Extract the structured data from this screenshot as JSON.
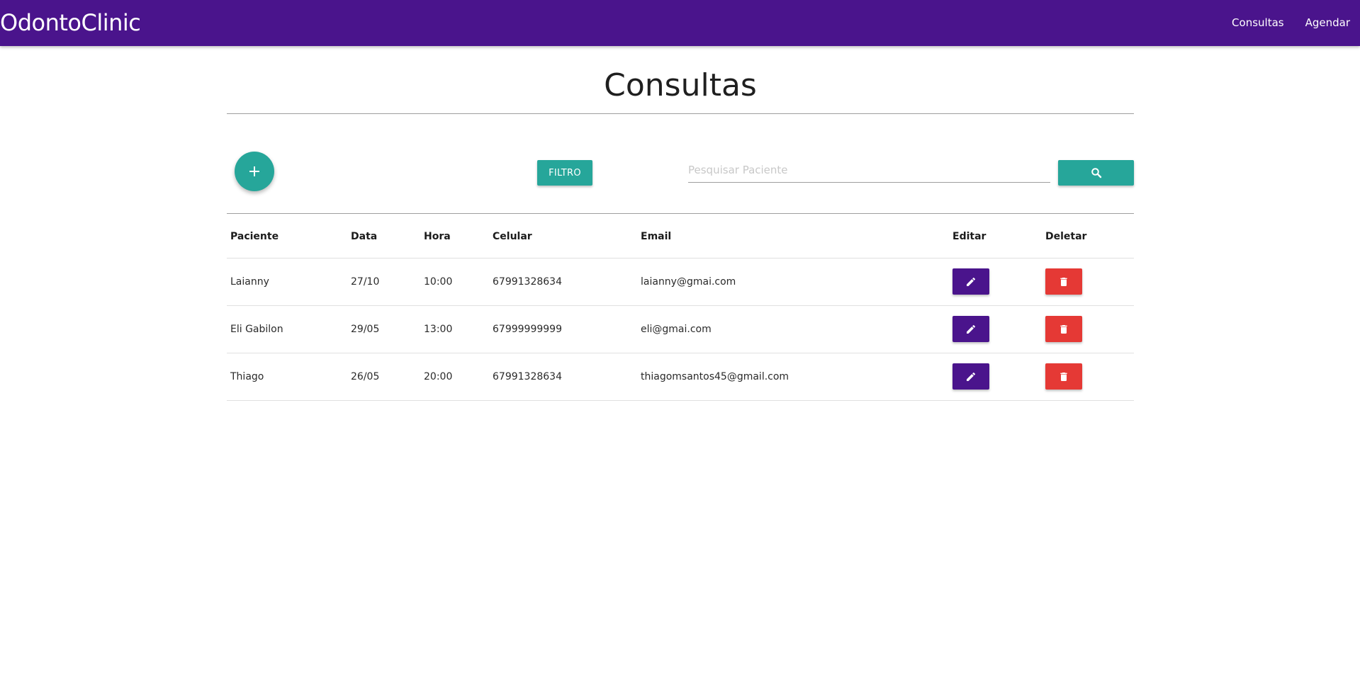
{
  "navbar": {
    "brand": "OdontoClinic",
    "links": [
      {
        "label": "Consultas"
      },
      {
        "label": "Agendar"
      }
    ],
    "color": "#4a148c"
  },
  "page": {
    "title": "Consultas"
  },
  "toolbar": {
    "add_icon": "plus-icon",
    "filter_label": "FILTRO",
    "search_placeholder": "Pesquisar Paciente",
    "search_value": "",
    "search_icon": "search-icon",
    "accent_color": "#26a69a"
  },
  "table": {
    "headers": {
      "paciente": "Paciente",
      "data": "Data",
      "hora": "Hora",
      "celular": "Celular",
      "email": "Email",
      "editar": "Editar",
      "deletar": "Deletar"
    },
    "rows": [
      {
        "paciente": "Laianny",
        "data": "27/10",
        "hora": "10:00",
        "celular": "67991328634",
        "email": "laianny@gmai.com"
      },
      {
        "paciente": "Eli Gabilon",
        "data": "29/05",
        "hora": "13:00",
        "celular": "67999999999",
        "email": "eli@gmai.com"
      },
      {
        "paciente": "Thiago",
        "data": "26/05",
        "hora": "20:00",
        "celular": "67991328634",
        "email": "thiagomsantos45@gmail.com"
      }
    ],
    "edit_icon": "pencil-icon",
    "delete_icon": "trash-icon",
    "edit_color": "#4a148c",
    "delete_color": "#e53935"
  }
}
